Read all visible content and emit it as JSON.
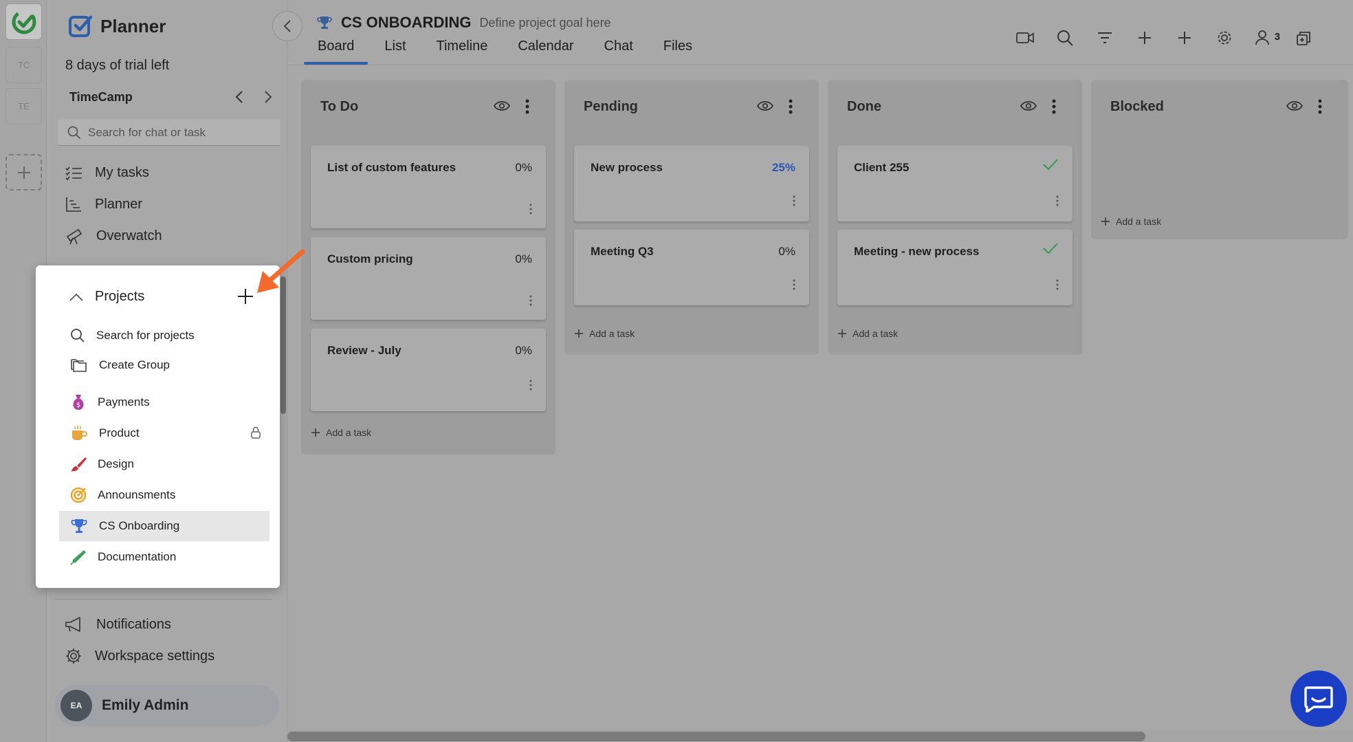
{
  "rail": {
    "workspaces": [
      "TC",
      "TE"
    ]
  },
  "sidebar": {
    "brand": "Planner",
    "collapse_label": "Collapse sidebar",
    "trial_text": "8 days of trial left",
    "workspace_name": "TimeCamp",
    "search_placeholder": "Search for chat or task",
    "nav": {
      "my_tasks": "My tasks",
      "planner": "Planner",
      "overwatch": "Overwatch",
      "notifications": "Notifications",
      "workspace_settings": "Workspace settings"
    },
    "user": {
      "initials": "EA",
      "name": "Emily Admin"
    }
  },
  "header": {
    "project_title": "CS ONBOARDING",
    "project_goal": "Define project goal here",
    "tabs": [
      "Board",
      "List",
      "Timeline",
      "Calendar",
      "Chat",
      "Files"
    ],
    "active_tab": "Board",
    "tools": [
      "video-call-icon",
      "search-icon",
      "filter-icon",
      "add-icon",
      "add-column-icon",
      "settings-icon",
      "members-icon",
      "apps-icon"
    ],
    "members_count": "3"
  },
  "board": {
    "add_task_label": "Add a task",
    "columns": [
      {
        "name": "To Do",
        "cards": [
          {
            "title": "List of custom features",
            "progress": "0%"
          },
          {
            "title": "Custom pricing",
            "progress": "0%"
          },
          {
            "title": "Review - July",
            "progress": "0%"
          }
        ]
      },
      {
        "name": "Pending",
        "cards": [
          {
            "title": "New process",
            "progress": "25%"
          },
          {
            "title": "Meeting Q3",
            "progress": "0%"
          }
        ]
      },
      {
        "name": "Done",
        "cards": [
          {
            "title": "Client 255",
            "status": "completed"
          },
          {
            "title": "Meeting - new process",
            "status": "completed"
          }
        ]
      },
      {
        "name": "Blocked",
        "cards": []
      }
    ]
  },
  "projects_popup": {
    "title": "Projects",
    "search_label": "Search for projects",
    "create_group_label": "Create Group",
    "items": [
      {
        "name": "Payments",
        "icon": "money-bag-icon",
        "color": "#b13fa0"
      },
      {
        "name": "Product",
        "icon": "coffee-icon",
        "color": "#e9a43a",
        "locked": true
      },
      {
        "name": "Design",
        "icon": "brush-icon",
        "color": "#c8323c"
      },
      {
        "name": "Announsments",
        "icon": "target-icon",
        "color": "#f0a020"
      },
      {
        "name": "CS Onboarding",
        "icon": "trophy-icon",
        "color": "#3b6fd4",
        "selected": true
      },
      {
        "name": "Documentation",
        "icon": "pen-icon",
        "color": "#3aa35a"
      }
    ]
  },
  "colors": {
    "accent": "#2f5fa8",
    "annotation_arrow": "#f26a2e",
    "check_green": "#2e9b4e",
    "progress_blue": "#2a58b5",
    "help_bubble": "#1a3fc4"
  }
}
